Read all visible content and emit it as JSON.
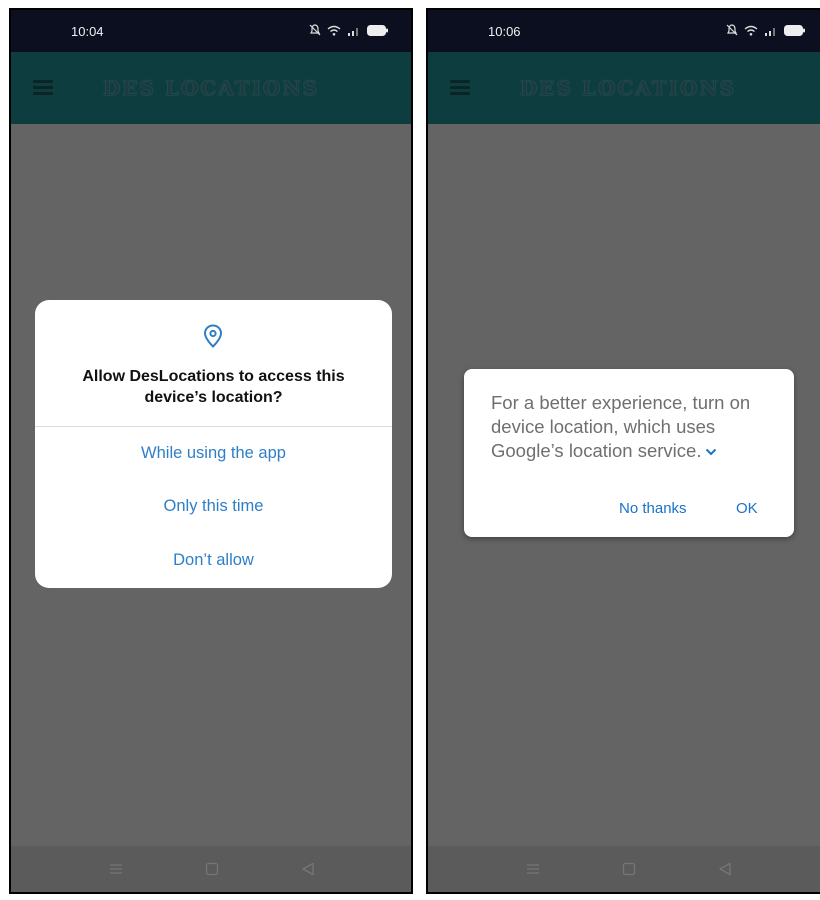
{
  "screens": [
    {
      "status_time": "10:04",
      "app_title": "DES LOCATIONS",
      "permission_dialog": {
        "title": "Allow DesLocations to access this device’s location?",
        "option_while_using": "While using the app",
        "option_only_this_time": "Only this time",
        "option_dont_allow": "Don’t allow"
      }
    },
    {
      "status_time": "10:06",
      "app_title": "DES LOCATIONS",
      "location_dialog": {
        "message": "For a better experience, turn on device location, which uses Google’s location service.",
        "no_thanks": "No thanks",
        "ok": "OK"
      }
    }
  ],
  "colors": {
    "status_bar": "#0b0f1f",
    "app_bar": "#0e3d3f",
    "scrim": "#646464",
    "accent_blue": "#2f7fc6",
    "dialog_bg": "#ffffff"
  },
  "icons": {
    "status": [
      "mute-icon",
      "wifi-icon",
      "signal-icon",
      "battery-icon"
    ],
    "appbar": [
      "menu-icon"
    ],
    "dialog": [
      "location-pin-icon",
      "chevron-down-icon"
    ],
    "nav": [
      "menu-nav-icon",
      "home-nav-icon",
      "back-nav-icon"
    ]
  }
}
